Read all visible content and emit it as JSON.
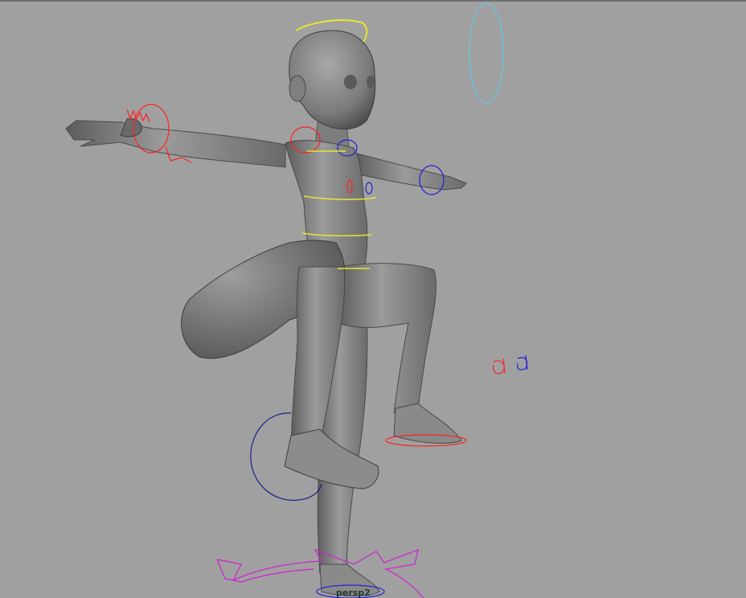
{
  "viewport": {
    "camera_name": "persp2",
    "background_color": "#a0a0a0"
  },
  "scene": {
    "model": "character-mesh",
    "rig_colors": {
      "left_side": "#ff2020",
      "right_side": "#2020d8",
      "center": "#e6e632",
      "global": "#d21fd2",
      "head_aux": "#5fc8e8",
      "pole_vector": "#1c1c8c"
    }
  }
}
